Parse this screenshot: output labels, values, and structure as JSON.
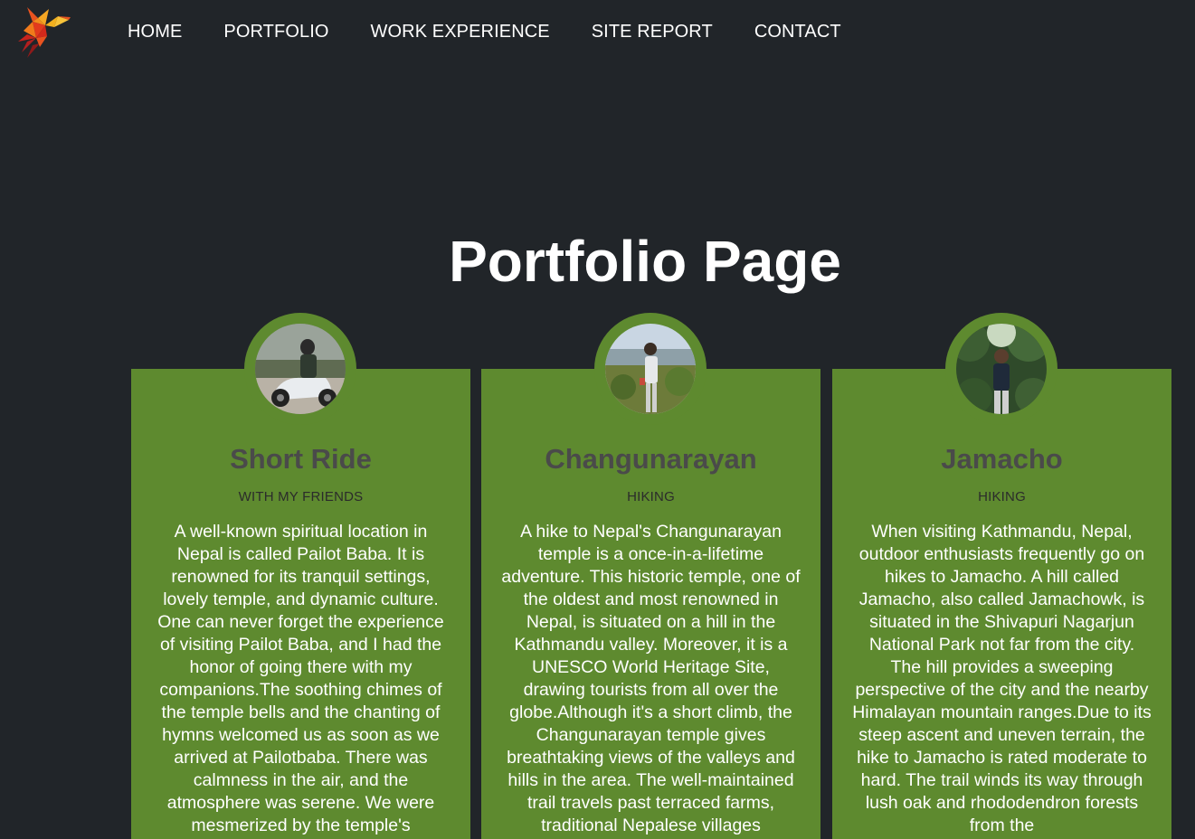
{
  "nav": {
    "logo_icon": "hummingbird-logo-icon",
    "items": [
      {
        "label": "HOME"
      },
      {
        "label": "PORTFOLIO"
      },
      {
        "label": "WORK EXPERIENCE"
      },
      {
        "label": "SITE REPORT"
      },
      {
        "label": "CONTACT"
      }
    ]
  },
  "main": {
    "title": "Portfolio Page"
  },
  "colors": {
    "background": "#212529",
    "card": "#5e8a2f",
    "card_title": "#4a4a4a"
  },
  "cards": [
    {
      "title": "Short Ride",
      "subtitle": "WITH MY FRIENDS",
      "photo": "person-on-scooter-photo",
      "text": "A well-known spiritual location in Nepal is called Pailot Baba. It is renowned for its tranquil settings, lovely temple, and dynamic culture. One can never forget the experience of visiting Pailot Baba, and I had the honor of going there with my companions.The soothing chimes of the temple bells and the chanting of hymns welcomed us as soon as we arrived at Pailotbaba. There was calmness in the air, and the atmosphere was serene. We were mesmerized by the temple's"
    },
    {
      "title": "Changunarayan",
      "subtitle": "HIKING",
      "photo": "person-standing-hills-photo",
      "text": "A hike to Nepal's Changunarayan temple is a once-in-a-lifetime adventure. This historic temple, one of the oldest and most renowned in Nepal, is situated on a hill in the Kathmandu valley. Moreover, it is a UNESCO World Heritage Site, drawing tourists from all over the globe.Although it's a short climb, the Changunarayan temple gives breathtaking views of the valleys and hills in the area. The well-maintained trail travels past terraced farms, traditional Nepalese villages"
    },
    {
      "title": "Jamacho",
      "subtitle": "HIKING",
      "photo": "person-in-forest-photo",
      "text": "When visiting Kathmandu, Nepal, outdoor enthusiasts frequently go on hikes to Jamacho. A hill called Jamacho, also called Jamachowk, is situated in the Shivapuri Nagarjun National Park not far from the city. The hill provides a sweeping perspective of the city and the nearby Himalayan mountain ranges.Due to its steep ascent and uneven terrain, the hike to Jamacho is rated moderate to hard. The trail winds its way through lush oak and rhododendron forests from the"
    }
  ]
}
